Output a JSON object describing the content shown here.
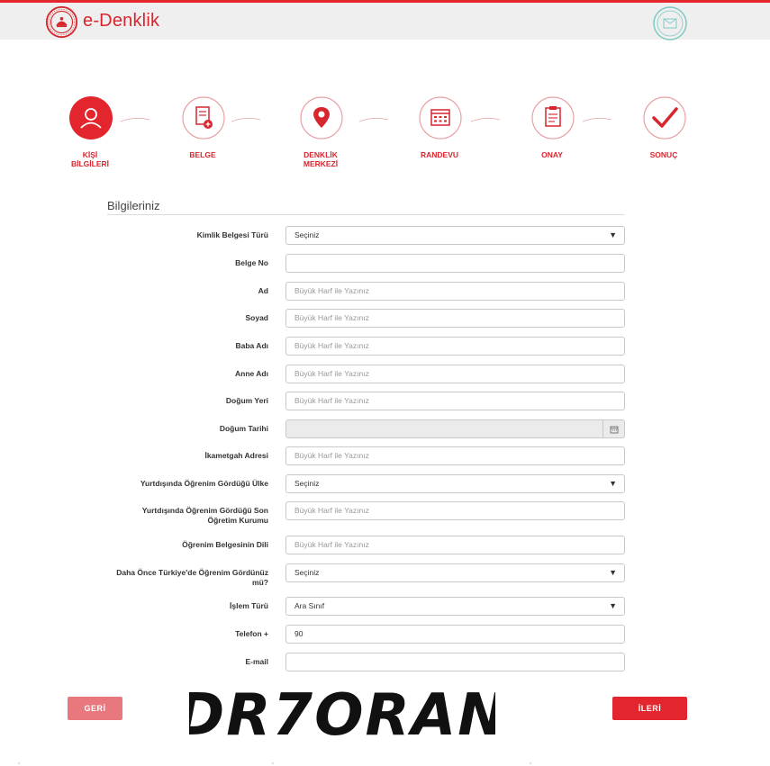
{
  "header": {
    "app_title": "e-Denklik"
  },
  "steps": [
    {
      "label": "KİŞİ BİLGİLERİ",
      "icon": "person-icon",
      "active": true
    },
    {
      "label": "BELGE",
      "icon": "document-add-icon",
      "active": false
    },
    {
      "label": "DENKLİK MERKEZİ",
      "icon": "location-pin-icon",
      "active": false
    },
    {
      "label": "RANDEVU",
      "icon": "calendar-icon",
      "active": false
    },
    {
      "label": "ONAY",
      "icon": "clipboard-icon",
      "active": false
    },
    {
      "label": "SONUÇ",
      "icon": "checkmark-icon",
      "active": false
    }
  ],
  "form": {
    "title": "Bilgileriniz",
    "fields": [
      {
        "label": "Kimlik Belgesi Türü",
        "type": "select",
        "value": "Seçiniz"
      },
      {
        "label": "Belge No",
        "type": "input",
        "value": "",
        "placeholder": ""
      },
      {
        "label": "Ad",
        "type": "input",
        "value": "",
        "placeholder": "Büyük Harf ile Yazınız"
      },
      {
        "label": "Soyad",
        "type": "input",
        "value": "",
        "placeholder": "Büyük Harf ile Yazınız"
      },
      {
        "label": "Baba Adı",
        "type": "input",
        "value": "",
        "placeholder": "Büyük Harf ile Yazınız"
      },
      {
        "label": "Anne Adı",
        "type": "input",
        "value": "",
        "placeholder": "Büyük Harf ile Yazınız"
      },
      {
        "label": "Doğum Yeri",
        "type": "input",
        "value": "",
        "placeholder": "Büyük Harf ile Yazınız"
      },
      {
        "label": "Doğum Tarihi",
        "type": "date",
        "value": ""
      },
      {
        "label": "İkametgah Adresi",
        "type": "input",
        "value": "",
        "placeholder": "Büyük Harf ile Yazınız"
      },
      {
        "label": "Yurtdışında Öğrenim Gördüğü Ülke",
        "type": "select",
        "value": "Seçiniz"
      },
      {
        "label": "Yurtdışında Öğrenim Gördüğü Son Öğretim Kurumu",
        "type": "input",
        "value": "",
        "placeholder": "Büyük Harf ile Yazınız"
      },
      {
        "label": "Öğrenim Belgesinin Dili",
        "type": "input",
        "value": "",
        "placeholder": "Büyük Harf ile Yazınız"
      },
      {
        "label": "Daha Önce Türkiye'de Öğrenim Gördünüz mü?",
        "type": "select",
        "value": "Seçiniz"
      },
      {
        "label": "İşlem Türü",
        "type": "select",
        "value": "Ara Sınıf"
      },
      {
        "label": "Telefon +",
        "type": "input",
        "value": "90",
        "placeholder": ""
      },
      {
        "label": "E-mail",
        "type": "input",
        "value": "",
        "placeholder": ""
      }
    ]
  },
  "buttons": {
    "back": "GERİ",
    "next": "İLERİ"
  },
  "watermark_text": "DR7ORAN",
  "colors": {
    "brand_red": "#e3262e",
    "back_button": "#e8787d"
  }
}
